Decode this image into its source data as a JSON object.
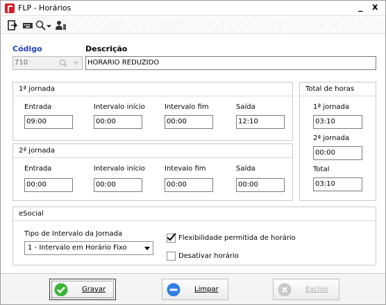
{
  "window": {
    "title": "FLP - Horários",
    "minimize": "_",
    "close": "x"
  },
  "toolbar": {
    "icons": [
      "exit-icon",
      "keyboard-icon",
      "search-icon",
      "dropdown-arrow-icon",
      "user-icon"
    ]
  },
  "header": {
    "codigo_label": "Código",
    "descricao_label": "Descrição",
    "codigo_value": "710",
    "descricao_value": "HORARIO REDUZIDO"
  },
  "jornada1": {
    "title": "1ª jornada",
    "entrada_label": "Entrada",
    "entrada": "09:00",
    "intervalo_inicio_label": "Intervalo início",
    "intervalo_inicio": "00:00",
    "intervalo_fim_label": "Intervalo fim",
    "intervalo_fim": "00:00",
    "saida_label": "Saída",
    "saida": "12:10"
  },
  "jornada2": {
    "title": "2ª jornada",
    "entrada_label": "Entrada",
    "entrada": "00:00",
    "intervalo_inicio_label": "Intervalo início",
    "intervalo_inicio": "00:00",
    "intervalo_fim_label": "Intevalo fim",
    "intervalo_fim": "00:00",
    "saida_label": "Saída",
    "saida": "00:00"
  },
  "total": {
    "title": "Total de horas",
    "j1_label": "1ª jornada",
    "j1": "03:10",
    "j2_label": "2ª jornada",
    "j2": "00:00",
    "total_label": "Total",
    "total": "03:10"
  },
  "esocial": {
    "title": "eSocial",
    "tipo_label": "Tipo de Intervalo da Jornada",
    "tipo_value": "1 - Intervalo em Horário Fixo",
    "flex_label": "Flexibilidade permitida de horário",
    "flex_checked": true,
    "desativar_label": "Desativar horário",
    "desativar_checked": false
  },
  "footer": {
    "gravar_label": "Gravar",
    "limpar_label": "Limpar",
    "excluir_label": "Excluir"
  },
  "colors": {
    "accent_blue": "#1c3fc0",
    "brand_red": "#d81e2a",
    "ok_green": "#3cb43c",
    "clear_blue": "#2f7fe0",
    "disabled_gray": "#c8c8c8"
  }
}
